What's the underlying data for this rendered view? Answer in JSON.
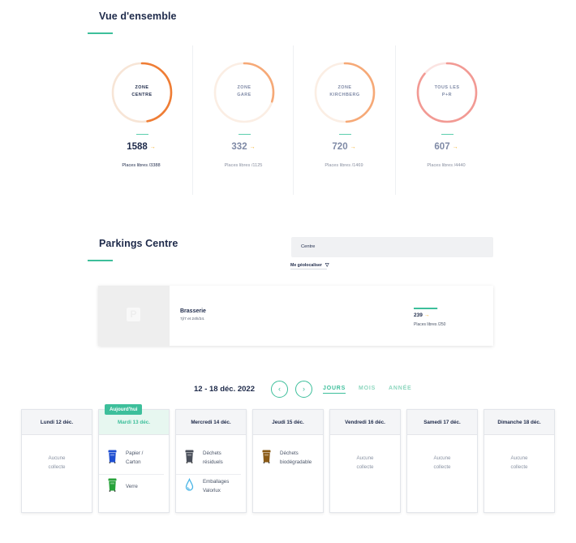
{
  "overview": {
    "title": "Vue d'ensemble",
    "zones": [
      {
        "label_line1": "ZONE",
        "label_line2": "CENTRE",
        "free": "1588",
        "arrow": "→",
        "subtitle": "Places libres /3388",
        "fill": 0.47,
        "color": "#ef7d35",
        "track": "#f7e5d6",
        "text_color": "#1e2a4a",
        "muted": false
      },
      {
        "label_line1": "ZONE",
        "label_line2": "GARE",
        "free": "332",
        "arrow": "→",
        "subtitle": "Places libres /1125",
        "fill": 0.3,
        "color": "#f6a977",
        "track": "#fbeee4",
        "text_color": "#7f8aa6",
        "muted": true
      },
      {
        "label_line1": "ZONE",
        "label_line2": "KIRCHBERG",
        "free": "720",
        "arrow": "→",
        "subtitle": "Places libres /1469",
        "fill": 0.49,
        "color": "#f6a977",
        "track": "#fbeee4",
        "text_color": "#7f8aa6",
        "muted": true
      },
      {
        "label_line1": "TOUS LES",
        "label_line2": "P+R",
        "free": "607",
        "arrow": "→",
        "subtitle": "Places libres /4440",
        "fill": 0.86,
        "color": "#f29a94",
        "track": "#fbe3e1",
        "text_color": "#7f8aa6",
        "muted": true
      }
    ]
  },
  "parkings": {
    "title": "Parkings Centre",
    "search_value": "Centre",
    "geolocate_label": "Me géolocaliser",
    "geolocate_icon": "▽",
    "card": {
      "logo": "P",
      "name": "Brasserie",
      "hours": "7j/7 et 24h/24.",
      "free": "239",
      "arrow": "→",
      "subtitle": "Places libres /250",
      "fill": 0.956
    }
  },
  "calendar": {
    "week_label": "12 - 18 déc. 2022",
    "prev_icon": "‹",
    "next_icon": "›",
    "tabs": [
      "JOURS",
      "MOIS",
      "ANNÉE"
    ],
    "today_badge": "Aujourd'hui",
    "none_line1": "Aucune",
    "none_line2": "collecte",
    "days": [
      {
        "label": "Lundi 12 déc.",
        "items": []
      },
      {
        "label": "Mardi 13 déc.",
        "today": true,
        "items": [
          {
            "line1": "Papier /",
            "line2": "Carton",
            "icon": "blue-bin-icon",
            "color": "#1f4fd1"
          },
          {
            "line1": "Verre",
            "line2": "",
            "icon": "green-bin-icon",
            "color": "#27a23a"
          }
        ]
      },
      {
        "label": "Mercredi 14 déc.",
        "items": [
          {
            "line1": "Déchets",
            "line2": "résiduels",
            "icon": "gray-bin-icon",
            "color": "#4a4f5a"
          },
          {
            "line1": "Emballages",
            "line2": "Valorlux",
            "icon": "water-drop-icon",
            "color": "#49b5e6"
          }
        ]
      },
      {
        "label": "Jeudi 15 déc.",
        "items": [
          {
            "line1": "Déchets",
            "line2": "biodégradable",
            "icon": "brown-bin-icon",
            "color": "#8a5a16"
          }
        ]
      },
      {
        "label": "Vendredi 16 déc.",
        "items": []
      },
      {
        "label": "Samedi 17 déc.",
        "items": []
      },
      {
        "label": "Dimanche 18 déc.",
        "items": []
      }
    ]
  }
}
